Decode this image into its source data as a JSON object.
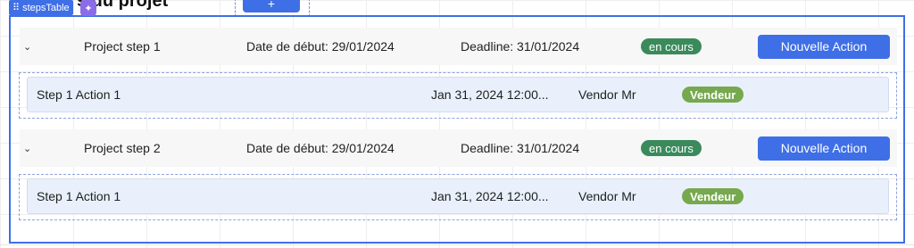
{
  "page": {
    "heading": "s du projet",
    "top_add_label": "+",
    "component_tag": "stepsTable",
    "drag_icon": "⠿",
    "sparkle_icon": "✦"
  },
  "steps": [
    {
      "chevron": "⌄",
      "name": "Project step 1",
      "start": "Date de début: 29/01/2024",
      "deadline": "Deadline: 31/01/2024",
      "status": "en cours",
      "button": "Nouvelle Action",
      "action": {
        "name": "Step 1 Action 1",
        "date": "Jan 31, 2024 12:00...",
        "vendor": "Vendor Mr",
        "badge": "Vendeur"
      }
    },
    {
      "chevron": "⌄",
      "name": "Project step 2",
      "start": "Date de début: 29/01/2024",
      "deadline": "Deadline: 31/01/2024",
      "status": "en cours",
      "button": "Nouvelle Action",
      "action": {
        "name": "Step 1 Action 1",
        "date": "Jan 31, 2024 12:00...",
        "vendor": "Vendor Mr",
        "badge": "Vendeur"
      }
    }
  ],
  "colors": {
    "accent": "#3f6fe6",
    "status_green": "#3a8a5c",
    "vendor_green": "#76a94e",
    "action_bg": "#e9f0fb"
  }
}
